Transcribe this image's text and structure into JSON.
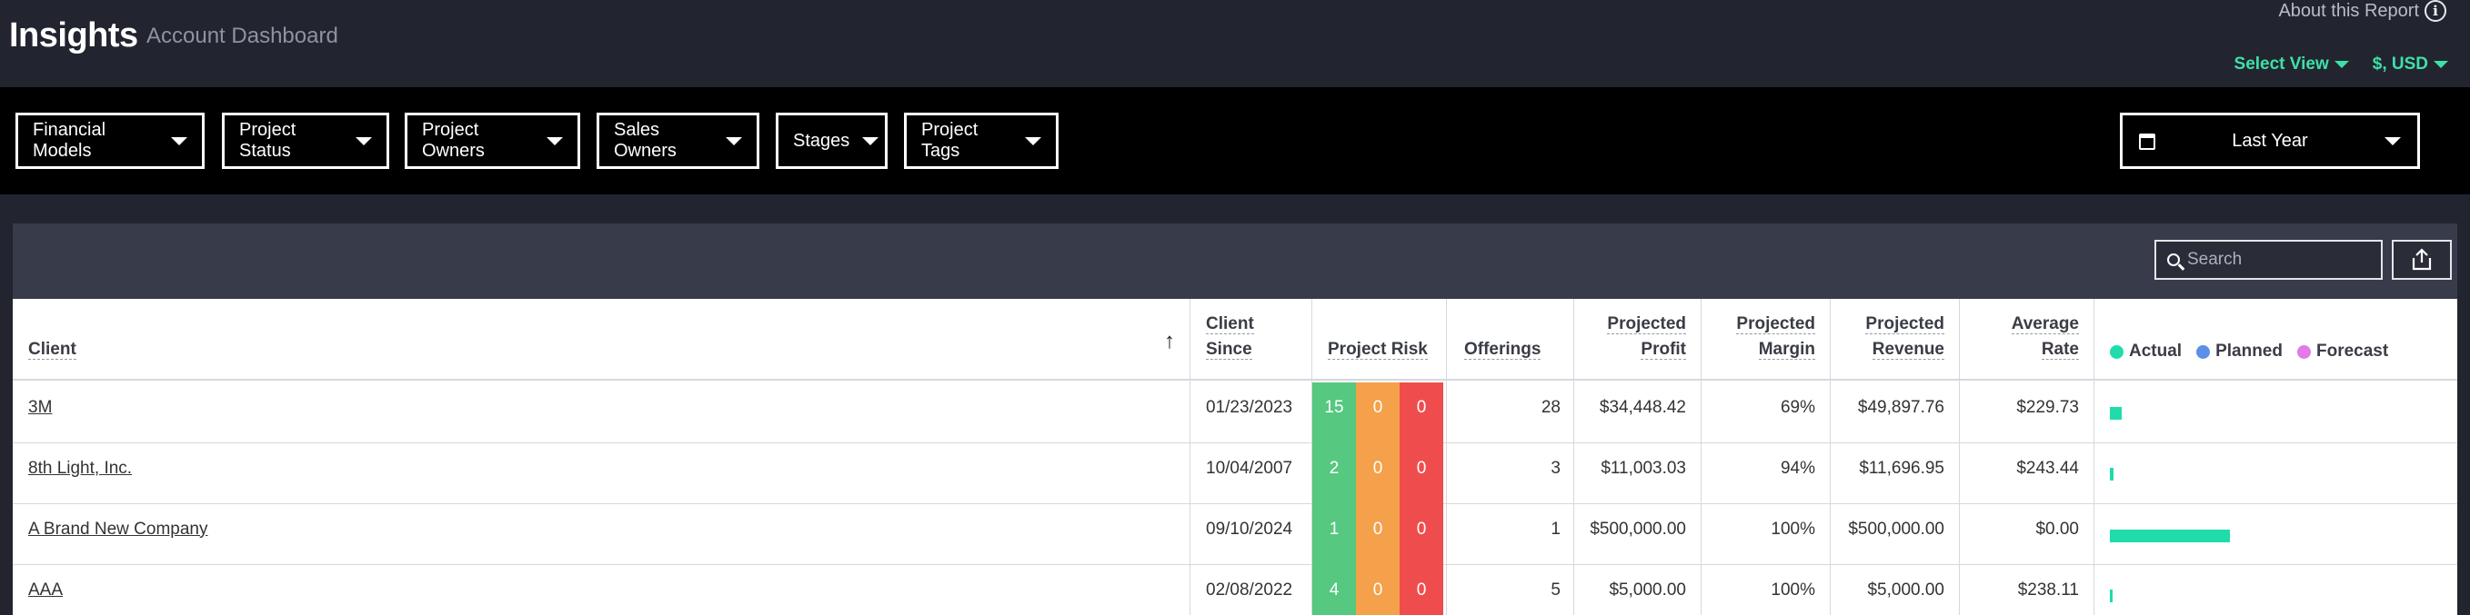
{
  "header": {
    "title": "Insights",
    "subtitle": "Account Dashboard",
    "about": "About this Report",
    "select_view": "Select View",
    "currency": "$, USD"
  },
  "filters": {
    "financial_models": "Financial Models",
    "project_status": "Project Status",
    "project_owners": "Project Owners",
    "sales_owners": "Sales Owners",
    "stages": "Stages",
    "project_tags": "Project Tags",
    "date_range": "Last Year"
  },
  "search": {
    "placeholder": "Search"
  },
  "table": {
    "columns": {
      "client": "Client",
      "client_since_1": "Client",
      "client_since_2": "Since",
      "project_risk": "Project Risk",
      "offerings": "Offerings",
      "proj_profit_1": "Projected",
      "proj_profit_2": "Profit",
      "proj_margin_1": "Projected",
      "proj_margin_2": "Margin",
      "proj_revenue_1": "Projected",
      "proj_revenue_2": "Revenue",
      "avg_rate_1": "Average",
      "avg_rate_2": "Rate"
    },
    "legend": {
      "actual": "Actual",
      "planned": "Planned",
      "forecast": "Forecast",
      "actual_color": "#1fdcaa",
      "planned_color": "#5b8fe8",
      "forecast_color": "#e27ae8"
    },
    "rows": [
      {
        "client": "3M",
        "since": "01/23/2023",
        "risk_green": "15",
        "risk_orange": "0",
        "risk_red": "0",
        "offerings": "28",
        "profit": "$34,448.42",
        "margin": "69%",
        "revenue": "$49,897.76",
        "rate": "$229.73",
        "actual_fraction": 0.1
      },
      {
        "client": "8th Light, Inc.",
        "since": "10/04/2007",
        "risk_green": "2",
        "risk_orange": "0",
        "risk_red": "0",
        "offerings": "3",
        "profit": "$11,003.03",
        "margin": "94%",
        "revenue": "$11,696.95",
        "rate": "$243.44",
        "actual_fraction": 0.03
      },
      {
        "client": "A Brand New Company",
        "since": "09/10/2024",
        "risk_green": "1",
        "risk_orange": "0",
        "risk_red": "0",
        "offerings": "1",
        "profit": "$500,000.00",
        "margin": "100%",
        "revenue": "$500,000.00",
        "rate": "$0.00",
        "actual_fraction": 1.0
      },
      {
        "client": "AAA",
        "since": "02/08/2022",
        "risk_green": "4",
        "risk_orange": "0",
        "risk_red": "0",
        "offerings": "5",
        "profit": "$5,000.00",
        "margin": "100%",
        "revenue": "$5,000.00",
        "rate": "$238.11",
        "actual_fraction": 0.02
      }
    ]
  }
}
